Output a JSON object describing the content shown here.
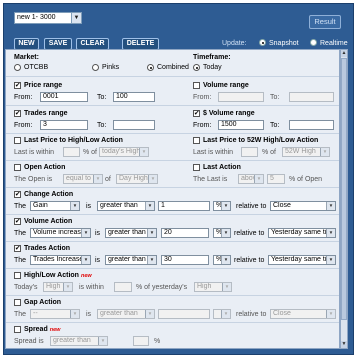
{
  "toolbar": {
    "preset": "new 1- 3000",
    "result_label": "Result",
    "new_label": "NEW",
    "save_label": "SAVE",
    "clear_label": "CLEAR",
    "delete_label": "DELETE",
    "update_label": "Update:",
    "snapshot_label": "Snapshot",
    "realtime_label": "Realtime",
    "update_mode": "Snapshot"
  },
  "market": {
    "label": "Market:",
    "options": [
      "OTCBB",
      "Pinks",
      "Combined"
    ],
    "selected": "Combined"
  },
  "timeframe": {
    "label": "Timeframe:",
    "option": "Today",
    "selected": true
  },
  "price_range": {
    "label": "Price range",
    "checked": true,
    "from_label": "From:",
    "to_label": "To:",
    "from": "0001",
    "to": "100"
  },
  "volume_range": {
    "label": "Volume range",
    "checked": false,
    "from_label": "From:",
    "to_label": "To:",
    "from": "",
    "to": ""
  },
  "trades_range": {
    "label": "Trades range",
    "checked": true,
    "from_label": "From:",
    "to_label": "To:",
    "from": "3",
    "to": ""
  },
  "dollar_volume_range": {
    "label": "$ Volume range",
    "checked": true,
    "from_label": "From:",
    "to_label": "To:",
    "from": "1500",
    "to": ""
  },
  "last_price_to_high_low": {
    "label": "Last Price to High/Low Action",
    "checked": false,
    "prefix": "Last is within",
    "pct_label": "% of",
    "target": "today's High"
  },
  "last_price_to_52w": {
    "label": "Last Price to 52W High/Low Action",
    "checked": false,
    "prefix": "Last is within",
    "pct_label": "% of",
    "target": "52W High"
  },
  "open_action": {
    "label": "Open Action",
    "checked": false,
    "prefix": "The Open is",
    "operator": "equal to",
    "target": "Day High"
  },
  "last_action": {
    "label": "Last Action",
    "checked": false,
    "prefix": "The Last is",
    "operator": "above",
    "value": "5",
    "suffix": "% of Open"
  },
  "change_action": {
    "label": "Change Action",
    "checked": true,
    "field": "Gain",
    "is_label": "is",
    "operator": "greater than",
    "value": "1",
    "unit": "%",
    "relative_label": "relative to",
    "relative_to": "Close"
  },
  "volume_action": {
    "label": "Volume Action",
    "checked": true,
    "field": "Volume increase",
    "is_label": "is",
    "operator": "greater than",
    "value": "20",
    "unit": "%",
    "relative_label": "relative to",
    "relative_to": "Yesterday same tim"
  },
  "trades_action": {
    "label": "Trades Action",
    "checked": true,
    "field": "Trades Increase",
    "is_label": "is",
    "operator": "greater than",
    "value": "30",
    "unit": "%",
    "relative_label": "relative to",
    "relative_to": "Yesterday same tim"
  },
  "high_low_action": {
    "label": "High/Low Action",
    "new_badge": "new",
    "checked": false,
    "prefix": "Today's",
    "field": "High",
    "within_label": "is within",
    "pct_label": "% of yesterday's",
    "target": "High"
  },
  "gap_action": {
    "label": "Gap Action",
    "checked": false,
    "prefix": "The",
    "field": "--",
    "is_label": "is",
    "operator": "greater than",
    "relative_label": "relative to",
    "relative_to": "Close"
  },
  "spread": {
    "label": "Spread",
    "new_badge": "new",
    "checked": false,
    "prefix": "Spread is",
    "operator": "greater than",
    "unit": "%"
  }
}
